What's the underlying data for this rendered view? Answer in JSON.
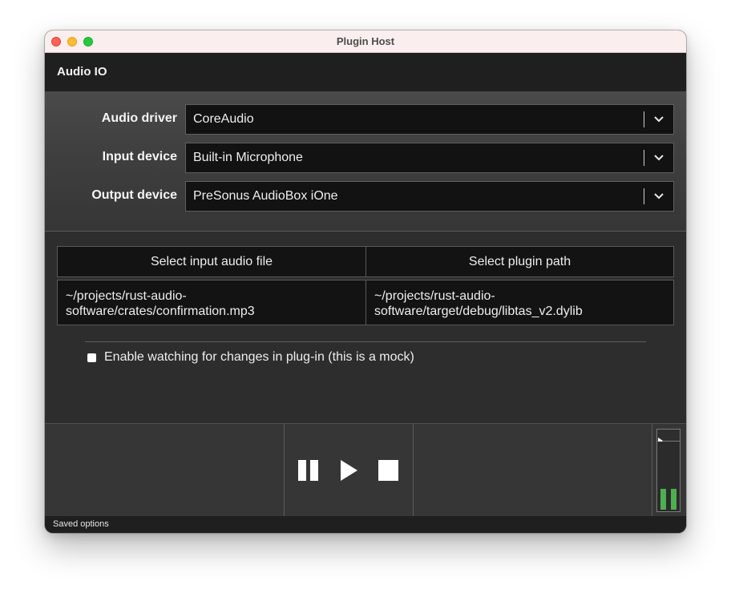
{
  "window": {
    "title": "Plugin Host"
  },
  "header": {
    "title": "Audio IO"
  },
  "settings": {
    "audio_driver": {
      "label": "Audio driver",
      "value": "CoreAudio"
    },
    "input_device": {
      "label": "Input device",
      "value": "Built-in Microphone"
    },
    "output_device": {
      "label": "Output device",
      "value": "PreSonus AudioBox iOne"
    }
  },
  "files": {
    "input_button": "Select input audio file",
    "plugin_button": "Select plugin path",
    "input_path": "~/projects/rust-audio-software/crates/confirmation.mp3",
    "input_path_line1": "~/projects/rust-audio-",
    "input_path_line2": "software/crates/confirmation.mp3",
    "plugin_path_line1": "~/projects/rust-audio-",
    "plugin_path_line2": "software/target/debug/libtas_v2.dylib"
  },
  "watch": {
    "label": "Enable watching for changes in plug-in (this is a mock)",
    "checked": false
  },
  "transport": {
    "pause_icon": "pause-icon",
    "play_icon": "play-icon",
    "stop_icon": "stop-icon"
  },
  "meter": {
    "left_level": 0.3,
    "right_level": 0.3,
    "color": "#4caf50"
  },
  "status": {
    "text": "Saved options"
  },
  "colors": {
    "titlebar": "#fbeeee",
    "header": "#1f1f1f",
    "background": "#2b2b2b",
    "accent_green": "#4caf50"
  }
}
